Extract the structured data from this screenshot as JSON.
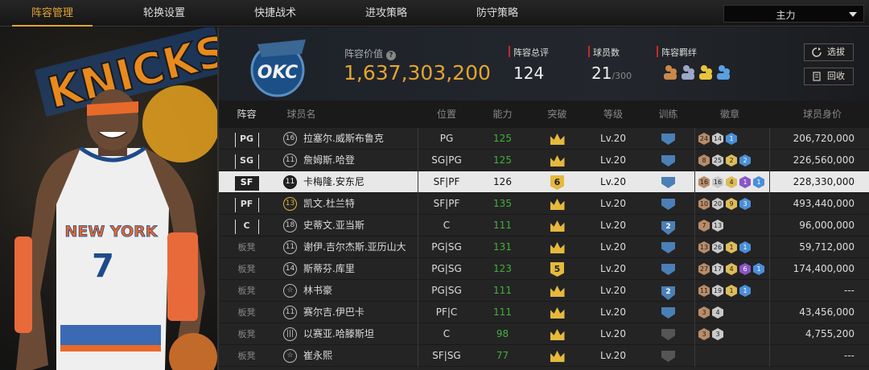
{
  "tabs": [
    {
      "label": "阵容管理",
      "active": true
    },
    {
      "label": "轮换设置"
    },
    {
      "label": "快捷战术"
    },
    {
      "label": "进攻策略"
    },
    {
      "label": "防守策略"
    }
  ],
  "mode_select": {
    "value": "主力"
  },
  "team_logo": {
    "name": "OKC"
  },
  "left_panel": {
    "player_number": "7",
    "jersey_text": "NEW YORK",
    "banner_text": "KNICKS"
  },
  "header": {
    "roster_value_label": "阵容价值",
    "roster_value": "1,637,303,200",
    "overall_label": "阵容总评",
    "overall": "124",
    "count_label": "球员数",
    "count": "21",
    "count_max": "/300",
    "chemistry_label": "阵容羁绊",
    "select_button": "选拔",
    "recycle_button": "回收"
  },
  "columns": [
    "阵容",
    "球员名",
    "位置",
    "能力",
    "突破",
    "等级",
    "训练",
    "徽章",
    "球员身价"
  ],
  "rows": [
    {
      "slot": "PG",
      "starter": true,
      "number": "16",
      "name": "拉塞尔.威斯布鲁克",
      "position": "PG",
      "ability": "125",
      "green": true,
      "breakthrough": "crown",
      "level": "Lv.20",
      "training": "",
      "badges": [
        [
          "bronze",
          "24"
        ],
        [
          "silver",
          "14"
        ],
        [
          "blue",
          "1"
        ]
      ],
      "value": "206,720,000"
    },
    {
      "slot": "SG",
      "starter": true,
      "number": "11",
      "name": "詹姆斯.哈登",
      "position": "SG|PG",
      "ability": "125",
      "green": true,
      "breakthrough": "crown",
      "level": "Lv.20",
      "training": "",
      "badges": [
        [
          "bronze",
          "8"
        ],
        [
          "silver",
          "25"
        ],
        [
          "gold",
          "2"
        ],
        [
          "blue",
          "2"
        ]
      ],
      "value": "226,560,000"
    },
    {
      "slot": "SF",
      "starter": true,
      "selected": true,
      "number": "11",
      "name": "卡梅隆.安东尼",
      "position": "SF|PF",
      "ability": "126",
      "green": false,
      "breakthrough": "6",
      "level": "Lv.20",
      "training": "",
      "badges": [
        [
          "bronze",
          "16"
        ],
        [
          "silver",
          "16"
        ],
        [
          "gold",
          "4"
        ],
        [
          "purple",
          "1"
        ],
        [
          "blue",
          "1"
        ]
      ],
      "value": "228,330,000"
    },
    {
      "slot": "PF",
      "starter": true,
      "number": "13",
      "gold_number": true,
      "name": "凯文.杜兰特",
      "position": "SF|PF",
      "ability": "135",
      "green": true,
      "breakthrough": "crown",
      "level": "Lv.20",
      "training": "",
      "badges": [
        [
          "bronze",
          "10"
        ],
        [
          "silver",
          "20"
        ],
        [
          "gold",
          "9"
        ],
        [
          "blue",
          "3"
        ]
      ],
      "value": "493,440,000"
    },
    {
      "slot": "C",
      "starter": true,
      "number": "18",
      "name": "史蒂文.亚当斯",
      "position": "C",
      "ability": "111",
      "green": true,
      "breakthrough": "crown",
      "level": "Lv.20",
      "training": "2",
      "badges": [
        [
          "bronze",
          "7"
        ],
        [
          "silver",
          "13"
        ]
      ],
      "value": "96,000,000"
    },
    {
      "slot": "板凳",
      "starter": false,
      "number": "11",
      "name": "谢伊.吉尔杰斯.亚历山大",
      "position": "PG|SG",
      "ability": "131",
      "green": true,
      "breakthrough": "crown",
      "level": "Lv.20",
      "training": "",
      "badges": [
        [
          "bronze",
          "13"
        ],
        [
          "silver",
          "26"
        ],
        [
          "gold",
          "1"
        ],
        [
          "blue",
          "1"
        ]
      ],
      "value": "59,712,000"
    },
    {
      "slot": "板凳",
      "starter": false,
      "number": "14",
      "name": "斯蒂芬.库里",
      "position": "PG|SG",
      "ability": "123",
      "green": true,
      "breakthrough": "5",
      "level": "Lv.20",
      "training": "",
      "badges": [
        [
          "bronze",
          "27"
        ],
        [
          "silver",
          "17"
        ],
        [
          "gold",
          "4"
        ],
        [
          "purple",
          "6"
        ],
        [
          "blue",
          "1"
        ]
      ],
      "value": "174,400,000"
    },
    {
      "slot": "板凳",
      "starter": false,
      "number": "☆",
      "name": "林书豪",
      "position": "PG|SG",
      "ability": "111",
      "green": true,
      "breakthrough": "crown",
      "level": "Lv.20",
      "training": "2",
      "badges": [
        [
          "bronze",
          "11"
        ],
        [
          "silver",
          "19"
        ],
        [
          "gold",
          "1"
        ],
        [
          "blue",
          "1"
        ]
      ],
      "value": "---"
    },
    {
      "slot": "板凳",
      "starter": false,
      "number": "11",
      "name": "赛尔吉.伊巴卡",
      "position": "PF|C",
      "ability": "111",
      "green": true,
      "breakthrough": "crown",
      "level": "Lv.20",
      "training": "",
      "badges": [
        [
          "bronze",
          "3"
        ],
        [
          "silver",
          "4"
        ]
      ],
      "value": "43,456,000"
    },
    {
      "slot": "板凳",
      "starter": false,
      "number": "|||",
      "name": "以赛亚.哈滕斯坦",
      "position": "C",
      "ability": "98",
      "green": true,
      "breakthrough": "crown",
      "level": "Lv.20",
      "training": "gray",
      "badges": [
        [
          "bronze",
          "3"
        ],
        [
          "silver",
          "3"
        ]
      ],
      "value": "4,755,200"
    },
    {
      "slot": "板凳",
      "starter": false,
      "number": "☆",
      "name": "崔永熙",
      "position": "SF|SG",
      "ability": "77",
      "green": true,
      "breakthrough": "crown",
      "level": "Lv.20",
      "training": "gray",
      "badges": [],
      "value": "---"
    }
  ]
}
